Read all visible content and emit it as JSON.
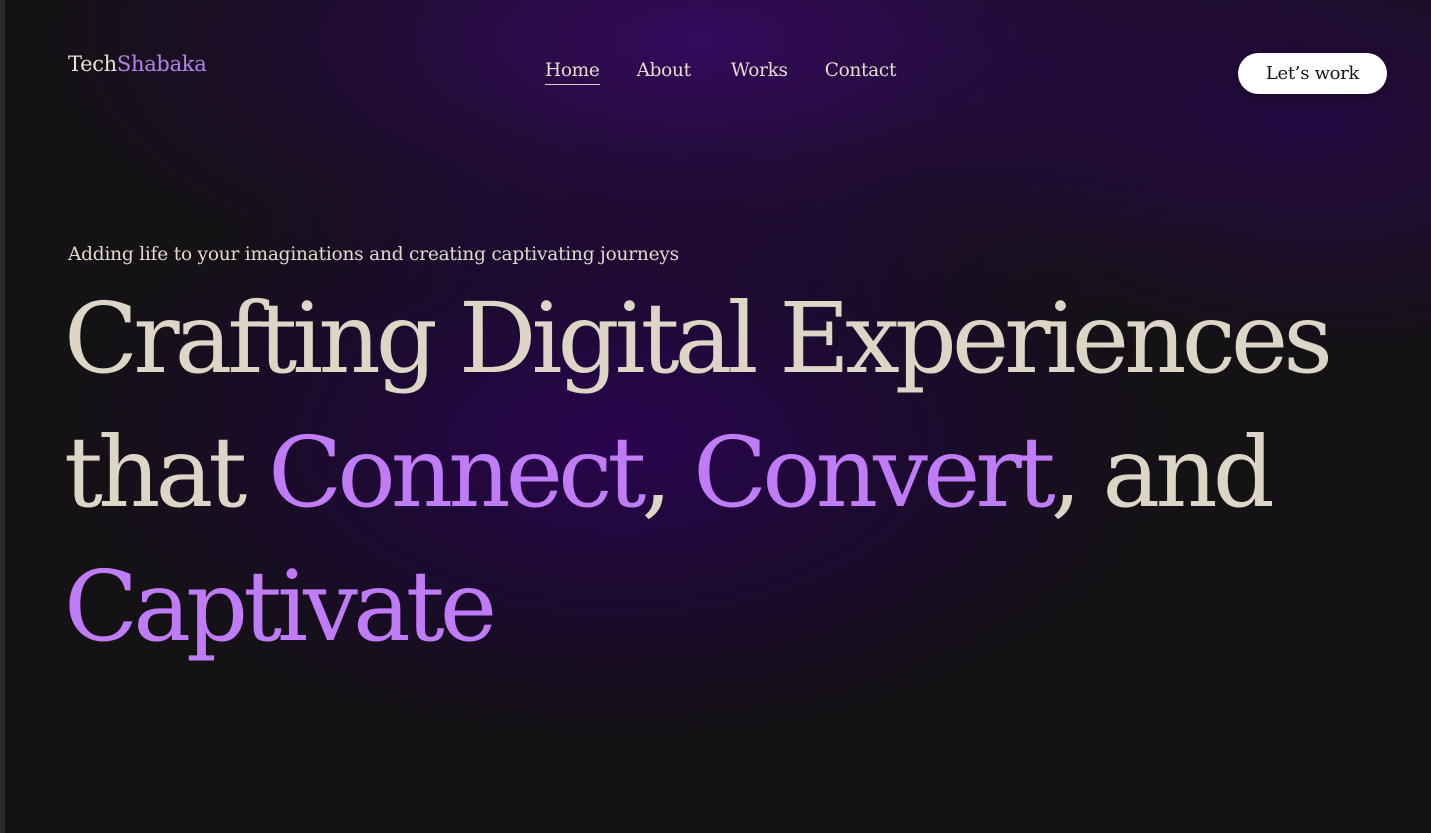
{
  "brand": {
    "part1": "Tech",
    "part2": "Shabaka",
    "accent_color": "#b882ee"
  },
  "nav": {
    "items": [
      {
        "label": "Home",
        "active": true
      },
      {
        "label": "About",
        "active": false
      },
      {
        "label": "Works",
        "active": false
      },
      {
        "label": "Contact",
        "active": false
      }
    ]
  },
  "cta": {
    "label": "Let’s work"
  },
  "hero": {
    "tagline": "Adding life to your imaginations and creating captivating journeys",
    "line1": "Crafting Digital Experiences",
    "line2_prefix": "that ",
    "line2_word1": "Connect",
    "line2_sep": ", ",
    "line2_word2": "Convert",
    "line2_suffix": ", and",
    "line3_word": "Captivate",
    "highlight_color": "#c07cf6",
    "text_color": "#ddd5c5"
  },
  "background": {
    "base_color": "#141214",
    "glow_color": "#3a0869"
  }
}
